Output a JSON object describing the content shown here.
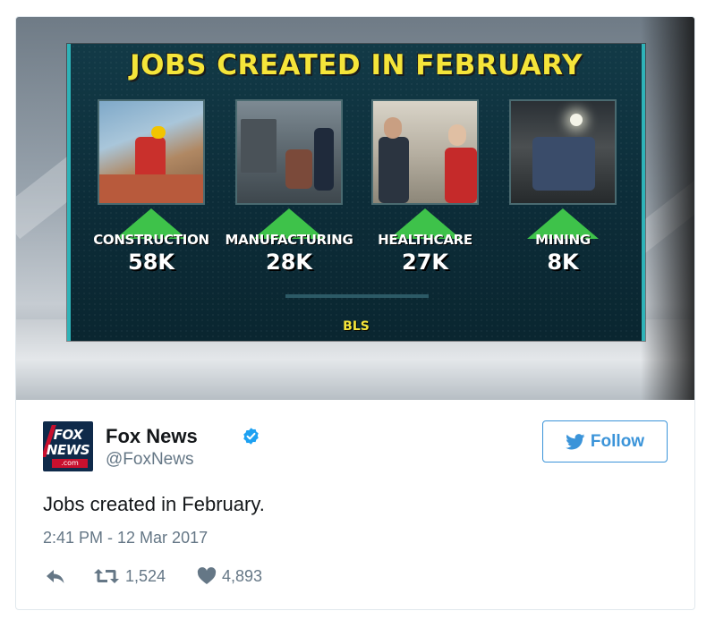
{
  "media": {
    "graphic_title": "JOBS CREATED IN FEBRUARY",
    "stats": [
      {
        "label": "CONSTRUCTION",
        "value": "58K"
      },
      {
        "label": "MANUFACTURING",
        "value": "28K"
      },
      {
        "label": "HEALTHCARE",
        "value": "27K"
      },
      {
        "label": "MINING",
        "value": "8K"
      }
    ],
    "source": "BLS",
    "arrow_color": "#3ec24a",
    "title_color": "#f5e53a"
  },
  "author": {
    "display_name": "Fox News",
    "handle": "@FoxNews",
    "avatar_text_line1": "FOX",
    "avatar_text_line2": "NEWS",
    "avatar_text_line3": ".com",
    "verified_icon": "verified-badge-icon"
  },
  "follow_button": {
    "label": "Follow",
    "icon": "twitter-bird-icon",
    "color": "#3b94d9"
  },
  "tweet": {
    "text": "Jobs created in February.",
    "timestamp": "2:41 PM - 12 Mar 2017"
  },
  "actions": {
    "reply_icon": "reply-icon",
    "retweet_icon": "retweet-icon",
    "retweet_count": "1,524",
    "like_icon": "heart-icon",
    "like_count": "4,893"
  }
}
